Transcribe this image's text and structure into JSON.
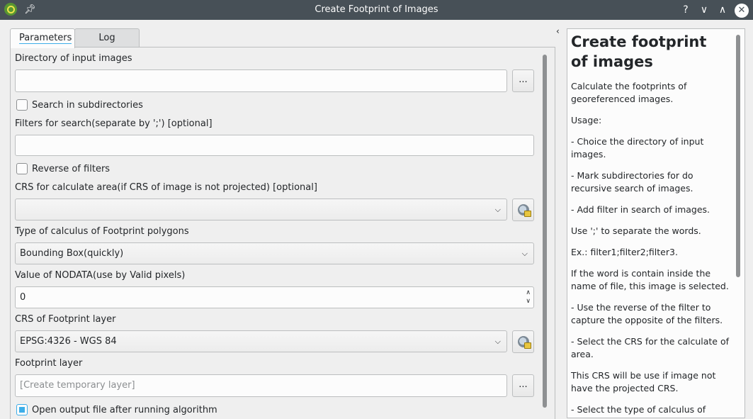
{
  "window": {
    "title": "Create Footprint of Images",
    "buttons": {
      "help": "?",
      "minimize": "∨",
      "maximize": "∧",
      "close": "✕"
    }
  },
  "tabs": [
    {
      "label": "Parameters",
      "active": true
    },
    {
      "label": "Log",
      "active": false
    }
  ],
  "form": {
    "input_dir_label": "Directory of input images",
    "input_dir_value": "",
    "browse_label": "...",
    "subdirs_label": "Search in subdirectories",
    "subdirs_checked": false,
    "filters_label": "Filters for search(separate by ';') [optional]",
    "filters_value": "",
    "reverse_label": "Reverse of filters",
    "reverse_checked": false,
    "crs_area_label": "CRS for calculate area(if CRS of image is not projected) [optional]",
    "crs_area_value": "",
    "calc_type_label": "Type of calculus of Footprint polygons",
    "calc_type_value": "Bounding Box(quickly)",
    "nodata_label": "Value of NODATA(use by Valid pixels)",
    "nodata_value": "0",
    "crs_fp_label": "CRS of Footprint layer",
    "crs_fp_value": "EPSG:4326 - WGS 84",
    "fp_layer_label": "Footprint layer",
    "fp_layer_placeholder": "[Create temporary layer]",
    "open_output_label": "Open output file after running algorithm",
    "open_output_checked": true
  },
  "help": {
    "title": "Create footprint of images",
    "paragraphs": [
      "Calculate the footprints of georeferenced images.",
      "Usage:",
      "- Choice the directory of input images.",
      "- Mark subdirectories for do recursive search of images.",
      "- Add filter in search of images.",
      "Use ';' to separate the words.",
      "Ex.: filter1;filter2;filter3.",
      "If the word is contain inside the name of file, this image is selected.",
      "- Use the reverse of the filter to capture the opposite of the filters.",
      "- Select the CRS for the calculate of area.",
      "This CRS will be use if image not have the projected CRS.",
      "- Select the type of calculus of"
    ]
  },
  "icons": {
    "app": "qgis-logo-icon",
    "pin": "pin-icon",
    "collapse": "chevron-left-icon",
    "crs_selector": "crs-globe-icon"
  }
}
